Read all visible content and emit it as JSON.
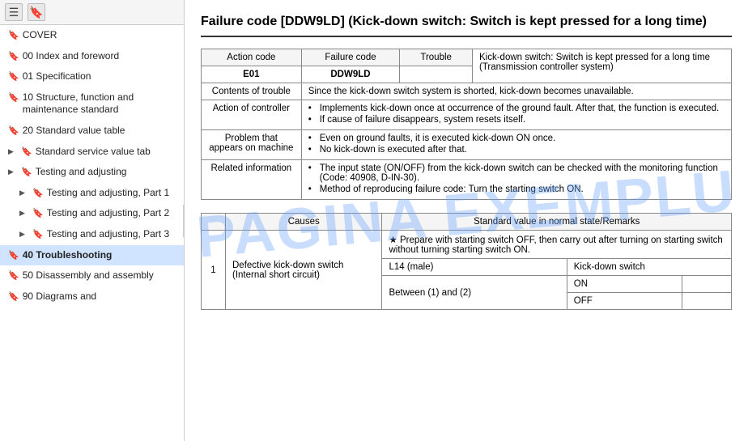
{
  "sidebar": {
    "toolbar": {
      "icon1": "☰",
      "icon2": "🔖"
    },
    "items": [
      {
        "id": "cover",
        "label": "COVER",
        "arrow": "",
        "indent": 0
      },
      {
        "id": "00-index",
        "label": "00 Index and foreword",
        "arrow": "",
        "indent": 0
      },
      {
        "id": "01-spec",
        "label": "01 Specification",
        "arrow": "",
        "indent": 0
      },
      {
        "id": "10-structure",
        "label": "10 Structure, function and maintenance standard",
        "arrow": "",
        "indent": 0
      },
      {
        "id": "20-standard",
        "label": "20 Standard value table",
        "arrow": "",
        "indent": 0
      },
      {
        "id": "std-service",
        "label": "Standard service value tab",
        "arrow": "▶",
        "indent": 0
      },
      {
        "id": "testing-adj",
        "label": "Testing and adjusting",
        "arrow": "▶",
        "indent": 0
      },
      {
        "id": "testing-adj-1",
        "label": "Testing and adjusting, Part 1",
        "arrow": "▶",
        "indent": 1
      },
      {
        "id": "testing-adj-2",
        "label": "Testing and adjusting, Part 2",
        "arrow": "▶",
        "indent": 1
      },
      {
        "id": "testing-adj-3",
        "label": "Testing and adjusting, Part 3",
        "arrow": "▶",
        "indent": 1
      },
      {
        "id": "40-trouble",
        "label": "40 Troubleshooting",
        "arrow": "",
        "indent": 0,
        "active": true
      },
      {
        "id": "50-disassembly",
        "label": "50 Disassembly and assembly",
        "arrow": "",
        "indent": 0
      },
      {
        "id": "90-diagrams",
        "label": "90 Diagrams and",
        "arrow": "",
        "indent": 0
      }
    ]
  },
  "main": {
    "title": "Failure code [DDW9LD] (Kick-down switch: Switch is kept pressed for a long time)",
    "action_code_header": "Action code",
    "failure_code_header": "Failure code",
    "trouble_header": "Trouble",
    "action_code_value": "E01",
    "failure_code_value": "DDW9LD",
    "trouble_text": "Kick-down switch: Switch is kept pressed for a long time (Transmission controller system)",
    "contents_of_trouble_label": "Contents of trouble",
    "contents_of_trouble_text": "Since the kick-down switch system is shorted, kick-down becomes unavailable.",
    "action_of_controller_label": "Action of controller",
    "action_of_controller_bullets": [
      "Implements kick-down once at occurrence of the ground fault. After that, the function is executed.",
      "If cause of failure disappears, system resets itself."
    ],
    "problem_label": "Problem that appears on machine",
    "problem_bullets": [
      "Even on ground faults, it is executed kick-down ON once.",
      "No kick-down is executed after that."
    ],
    "related_info_label": "Related information",
    "related_info_bullets": [
      "The input state (ON/OFF) from the kick-down switch can be checked with the monitoring function (Code: 40908, D-IN-30).",
      "Method of reproducing failure code: Turn the starting switch ON."
    ],
    "causes_header": "Causes",
    "standard_value_header": "Standard value in normal state/Remarks",
    "row_number": "1",
    "cause_label": "Defective kick-down switch (Internal short circuit)",
    "prepare_text": "★ Prepare with starting switch OFF, then carry out after turning on starting switch without turning starting switch ON.",
    "l14_label": "L14 (male)",
    "kickdown_switch_label": "Kick-down switch",
    "between_label": "Between (1) and (2)",
    "on_label": "ON",
    "off_label": "OFF"
  },
  "watermark": "PAGINA EXEMPLU"
}
